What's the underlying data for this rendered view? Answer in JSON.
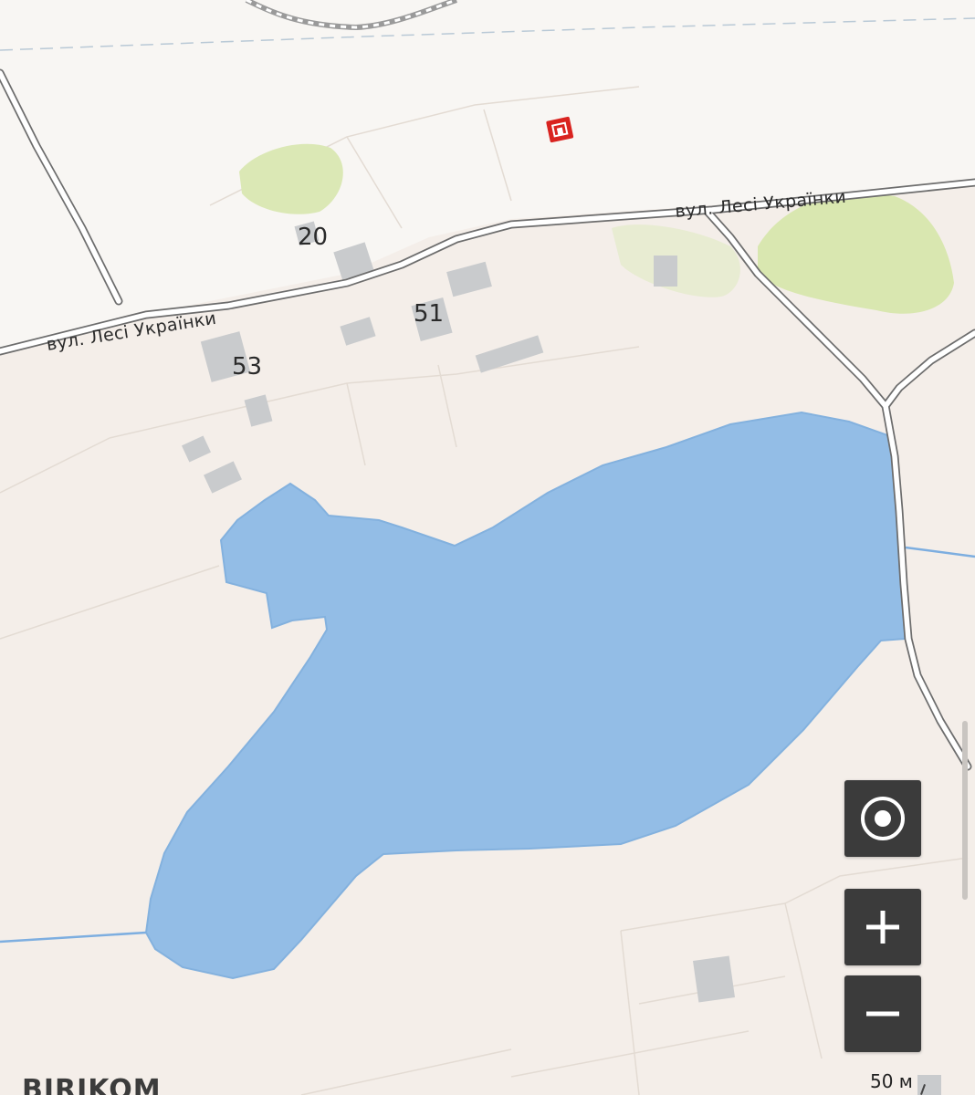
{
  "map": {
    "street_name": "вул. Лесі Українки",
    "house_numbers": [
      "20",
      "51",
      "53"
    ],
    "poi_icon": "shop-icon",
    "colors": {
      "water": "#93bde6",
      "water_stroke": "#83b1de",
      "ground": "#f4eee9",
      "road_fill": "#ffffff",
      "road_casing": "#6d6d6d",
      "park": "#d9e7b0",
      "building": "#c9cbcd",
      "poi": "#d9231f"
    }
  },
  "controls": {
    "locate_icon": "locate-icon",
    "zoom_in_icon": "plus-icon",
    "zoom_out_icon": "minus-icon",
    "button_color": "#3b3b3b"
  },
  "scale": {
    "label": "50 м"
  },
  "brand": {
    "name": "BIRIKOM"
  }
}
